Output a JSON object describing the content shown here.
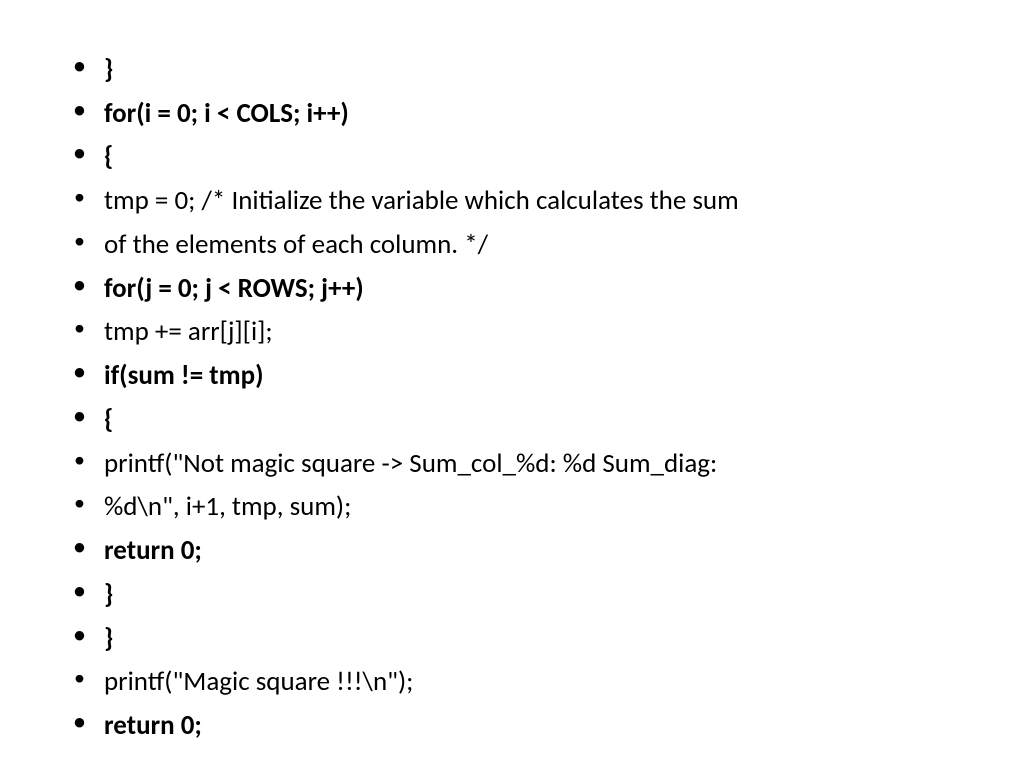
{
  "lines": [
    {
      "text": "}",
      "bold": true
    },
    {
      "text": "for(i = 0; i < COLS; i++)",
      "bold": true
    },
    {
      "text": "{",
      "bold": true
    },
    {
      "text": "tmp = 0; /* Initialize the variable which calculates the sum",
      "bold": false
    },
    {
      "text": "of the elements of each column. */",
      "bold": false
    },
    {
      "text": "for(j = 0; j < ROWS; j++)",
      "bold": true
    },
    {
      "text": "tmp += arr[j][i];",
      "bold": false
    },
    {
      "text": "if(sum != tmp)",
      "bold": true
    },
    {
      "text": "{",
      "bold": true
    },
    {
      "text": "printf(\"Not magic square -> Sum_col_%d: %d Sum_diag:",
      "bold": false
    },
    {
      "text": "%d\\n\", i+1, tmp, sum);",
      "bold": false
    },
    {
      "text": "return 0;",
      "bold": true
    },
    {
      "text": "}",
      "bold": true
    },
    {
      "text": "}",
      "bold": true
    },
    {
      "text": "printf(\"Magic square !!!\\n\");",
      "bold": false
    },
    {
      "text": "return 0;",
      "bold": true
    }
  ]
}
